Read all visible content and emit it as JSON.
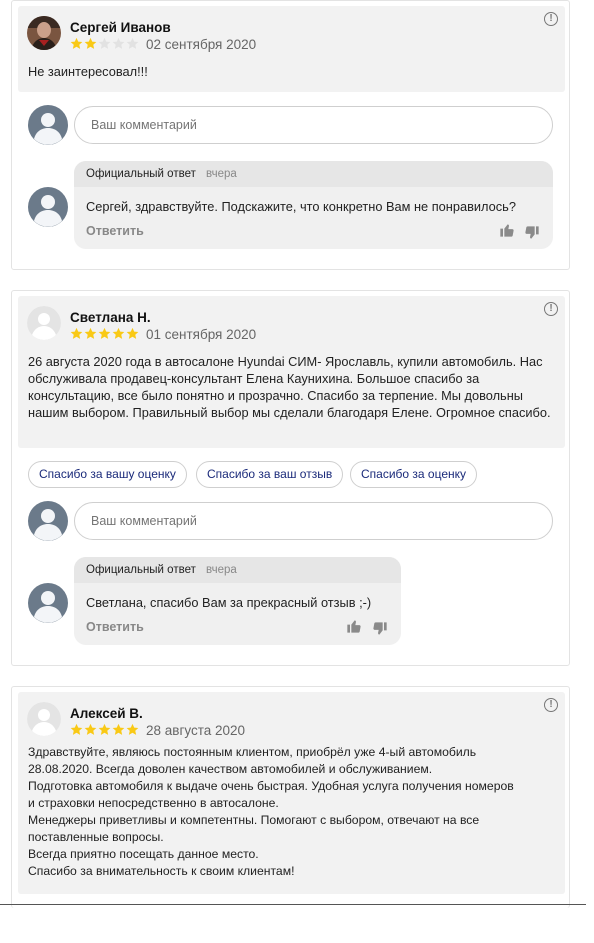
{
  "reviews": [
    {
      "author": "Сергей Иванов",
      "rating": 2,
      "date": "02 сентября 2020",
      "text": "Не заинтересовал!!!",
      "comment_placeholder": "Ваш комментарий",
      "reply": {
        "label": "Официальный ответ",
        "when": "вчера",
        "text": "Сергей, здравствуйте. Подскажите, что конкретно Вам не понравилось?",
        "answer_label": "Ответить"
      }
    },
    {
      "author": "Светлана Н.",
      "rating": 5,
      "date": "01 сентября 2020",
      "text": "26 августа 2020 года в автосалоне Hyundai СИМ- Ярославль, купили автомобиль. Нас обслуживала продавец-консультант Елена Каунихина. Большое спасибо за консультацию, все было понятно и прозрачно. Спасибо за терпение. Мы довольны нашим выбором. Правильный выбор мы сделали благодаря Елене. Огромное спасибо.",
      "chips": [
        "Спасибо за вашу оценку",
        "Спасибо за ваш отзыв",
        "Спасибо за оценку"
      ],
      "comment_placeholder": "Ваш комментарий",
      "reply": {
        "label": "Официальный ответ",
        "when": "вчера",
        "text": "Светлана, спасибо Вам за прекрасный отзыв ;-)",
        "answer_label": "Ответить"
      }
    },
    {
      "author": "Алексей В.",
      "rating": 5,
      "date": "28 августа 2020",
      "text_lines": [
        "Здравствуйте, являюсь постоянным клиентом, приобрёл уже 4-ый автомобиль",
        "28.08.2020. Всегда доволен качеством автомобилей и обслуживанием.",
        "Подготовка автомобиля к выдаче очень быстрая. Удобная услуга получения номеров",
        "и страховки непосредственно в автосалоне.",
        "Менеджеры приветливы и компетентны. Помогают с выбором, отвечают на все",
        "поставленные вопросы.",
        "Всегда приятно посещать данное место.",
        "Спасибо за внимательность к своим клиентам!"
      ]
    }
  ],
  "colors": {
    "star_filled": "#f9c916",
    "star_empty": "#e2e2e2",
    "chip_text": "#1a2a7a"
  },
  "icons": {
    "report": "exclamation-circle-icon",
    "like": "thumb-up-icon",
    "dislike": "thumb-down-icon",
    "avatar": "user-silhouette-icon"
  }
}
